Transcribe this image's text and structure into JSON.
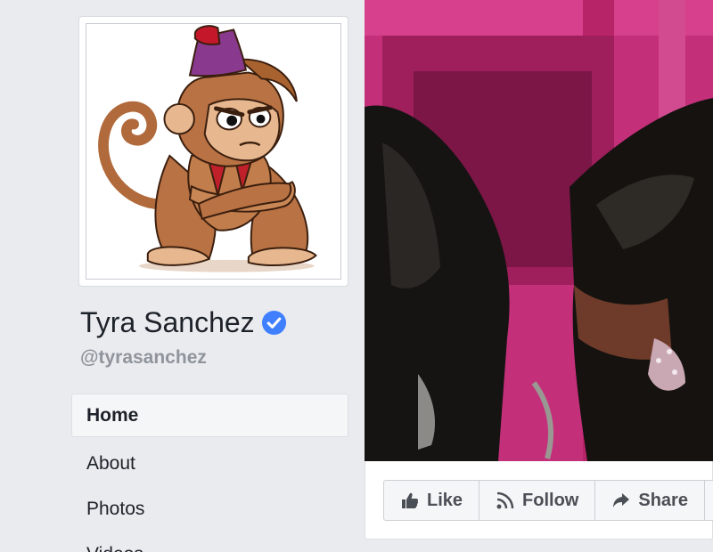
{
  "profile": {
    "name": "Tyra Sanchez",
    "handle": "@tyrasanchez",
    "verified": true,
    "picture_icon": "cartoon-monkey-avatar"
  },
  "nav": {
    "items": [
      {
        "label": "Home",
        "active": true
      },
      {
        "label": "About",
        "active": false
      },
      {
        "label": "Photos",
        "active": false
      },
      {
        "label": "Videos",
        "active": false
      }
    ]
  },
  "cover": {
    "icon": "cover-photo"
  },
  "actions": {
    "like_label": "Like",
    "follow_label": "Follow",
    "share_label": "Share"
  },
  "colors": {
    "background": "#e9ebee",
    "verified_badge": "#4080ff",
    "text_primary": "#1d2129",
    "text_secondary": "#90949c",
    "button_text": "#4b4f56"
  }
}
